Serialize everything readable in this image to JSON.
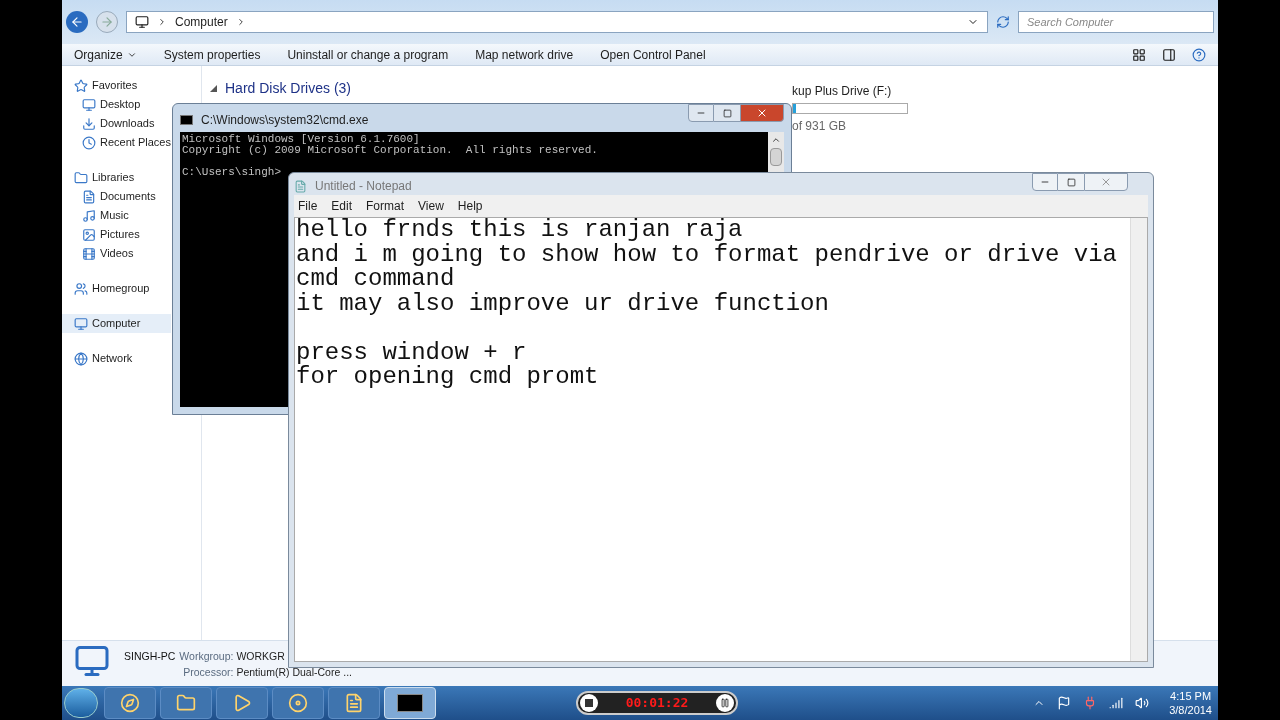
{
  "explorer": {
    "address": {
      "crumb": "Computer",
      "search_placeholder": "Search Computer"
    },
    "toolbar": [
      "Organize",
      "System properties",
      "Uninstall or change a program",
      "Map network drive",
      "Open Control Panel"
    ],
    "sidebar": {
      "items": [
        {
          "kind": "group",
          "label": "Favorites",
          "selected": false
        },
        {
          "kind": "item",
          "label": "Desktop",
          "selected": false
        },
        {
          "kind": "item",
          "label": "Downloads",
          "selected": false
        },
        {
          "kind": "item",
          "label": "Recent Places",
          "selected": false
        },
        {
          "kind": "group",
          "label": "Libraries",
          "selected": false
        },
        {
          "kind": "item",
          "label": "Documents",
          "selected": false
        },
        {
          "kind": "item",
          "label": "Music",
          "selected": false
        },
        {
          "kind": "item",
          "label": "Pictures",
          "selected": false
        },
        {
          "kind": "item",
          "label": "Videos",
          "selected": false
        },
        {
          "kind": "group",
          "label": "Homegroup",
          "selected": false
        },
        {
          "kind": "group",
          "label": "Computer",
          "selected": true
        },
        {
          "kind": "group",
          "label": "Network",
          "selected": false
        }
      ]
    },
    "section": {
      "title": "Hard Disk Drives (3)",
      "expanded": true
    },
    "drive": {
      "name": "kup Plus Drive (F:)",
      "level": 0.03,
      "free": "of 931 GB"
    },
    "details": {
      "name": "SINGH-PC",
      "workgroup_label": "Workgroup:",
      "workgroup": "WORKGR",
      "processor_label": "Processor:",
      "processor": "Pentium(R) Dual-Core ..."
    }
  },
  "cmd": {
    "title": "C:\\Windows\\system32\\cmd.exe",
    "lines": [
      "Microsoft Windows [Version 6.1.7600]",
      "Copyright (c) 2009 Microsoft Corporation.  All rights reserved."
    ],
    "prompt": "C:\\Users\\singh>"
  },
  "notepad": {
    "title": "Untitled - Notepad",
    "menu": [
      "File",
      "Edit",
      "Format",
      "View",
      "Help"
    ],
    "paragraphs": [
      [
        "hello frnds this is ranjan raja",
        "and i m going to show how to format pendrive or drive via",
        "cmd command",
        "it may also improve ur drive function"
      ],
      [
        "press window + r",
        "for opening cmd promt"
      ]
    ]
  },
  "taskbar": {
    "buttons": [
      {
        "selected": false
      },
      {
        "selected": false
      },
      {
        "selected": false
      },
      {
        "selected": false
      },
      {
        "selected": false
      },
      {
        "selected": true
      }
    ],
    "recorder": {
      "time": "00:01:22"
    },
    "clock": {
      "time": "4:15 PM",
      "date": "3/8/2014"
    }
  }
}
